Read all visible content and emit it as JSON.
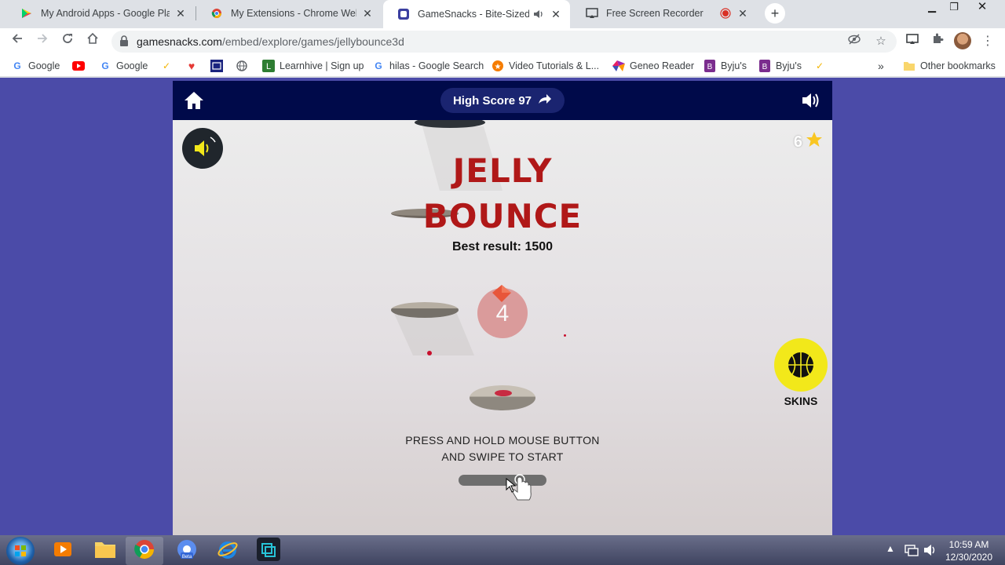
{
  "browser": {
    "tabs": [
      {
        "title": "My Android Apps - Google Play",
        "active": false
      },
      {
        "title": "My Extensions - Chrome Web St",
        "active": false
      },
      {
        "title": "GameSnacks - Bite-Sized Gar",
        "active": true
      },
      {
        "title": "Free Screen Recorder",
        "active": false
      }
    ],
    "url_host": "gamesnacks.com",
    "url_path": "/embed/explore/games/jellybounce3d",
    "bookmarks": [
      {
        "label": "Google"
      },
      {
        "label": ""
      },
      {
        "label": "Google"
      },
      {
        "label": ""
      },
      {
        "label": ""
      },
      {
        "label": ""
      },
      {
        "label": ""
      },
      {
        "label": "Learnhive | Sign up"
      },
      {
        "label": "hilas - Google Search"
      },
      {
        "label": "Video Tutorials & L..."
      },
      {
        "label": "Geneo Reader"
      },
      {
        "label": "Byju's"
      },
      {
        "label": "Byju's"
      },
      {
        "label": ""
      }
    ],
    "overflow": "»",
    "other_bookmarks": "Other bookmarks"
  },
  "game_header": {
    "high_score_label": "High Score 97"
  },
  "game": {
    "stars_count": "6",
    "title_line1": "JELLY",
    "title_line2": "BOUNCE",
    "best_result": "Best result: 1500",
    "ball_number": "4",
    "skins_label": "SKINS",
    "instruction_line1": "PRESS AND HOLD MOUSE BUTTON",
    "instruction_line2": "AND SWIPE TO START"
  },
  "taskbar": {
    "time": "10:59 AM",
    "date": "12/30/2020"
  },
  "colors": {
    "title_red": "#b01818",
    "header_navy": "#000a4a",
    "page_purple": "#4b4ba8",
    "skins_yellow": "#f2e81a"
  }
}
